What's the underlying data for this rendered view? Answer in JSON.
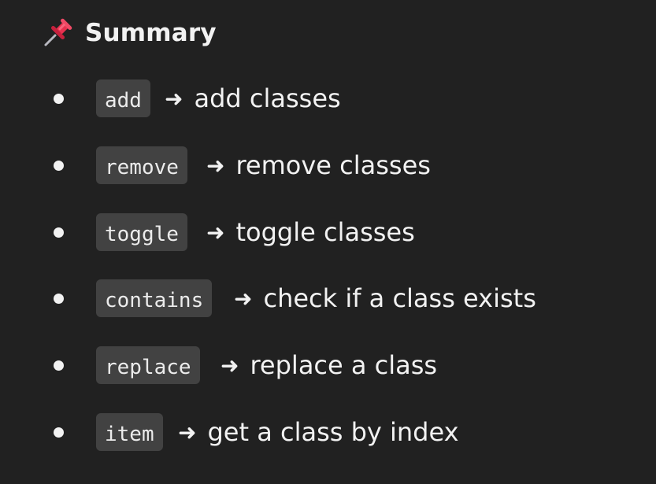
{
  "heading": {
    "icon": "pushpin-icon",
    "title": "Summary"
  },
  "arrow_glyph": "➜",
  "items": [
    {
      "code": "add",
      "description": "add classes"
    },
    {
      "code": "remove",
      "description": "remove classes"
    },
    {
      "code": "toggle",
      "description": "toggle classes"
    },
    {
      "code": "contains",
      "description": "check if a class exists"
    },
    {
      "code": "replace",
      "description": "replace a class"
    },
    {
      "code": "item",
      "description": "get a class by index"
    }
  ],
  "colors": {
    "background": "#212121",
    "text": "#f2f2f2",
    "code_background": "#424242",
    "pin_red": "#e8314f"
  }
}
